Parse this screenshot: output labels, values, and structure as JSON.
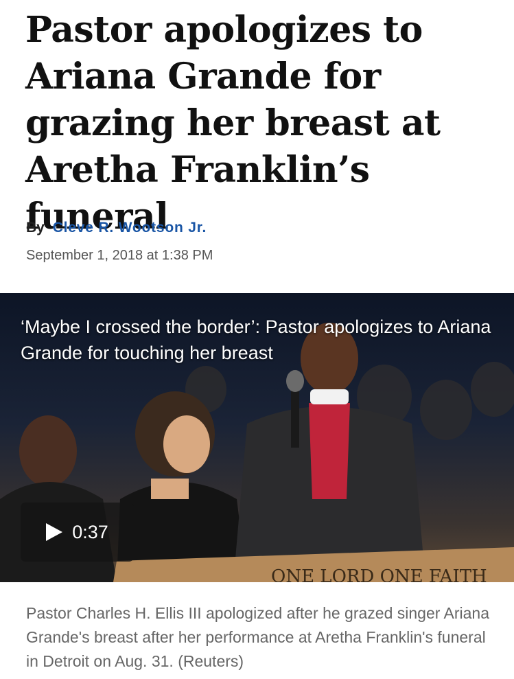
{
  "article": {
    "headline": "Pastor apologizes to Ariana Grande for grazing her breast at Aretha Franklin’s funeral",
    "byline_prefix": "By",
    "author": "Cleve R. Wootson Jr.",
    "date": "September 1, 2018 at 1:38 PM"
  },
  "video": {
    "title": "‘Maybe I crossed the border’: Pastor apologizes to Ariana Grande for touching her breast",
    "duration": "0:37",
    "podium_text": "ONE LORD  ONE FAITH",
    "caption": "Pastor Charles H. Ellis III apologized after he grazed singer Ariana Grande's breast after her performance at Aretha Franklin's funeral in Detroit on Aug. 31. (Reuters)"
  },
  "icons": {
    "play": "play-icon"
  },
  "colors": {
    "author_link": "#1955a5",
    "headline": "#111111",
    "caption": "#666666"
  }
}
